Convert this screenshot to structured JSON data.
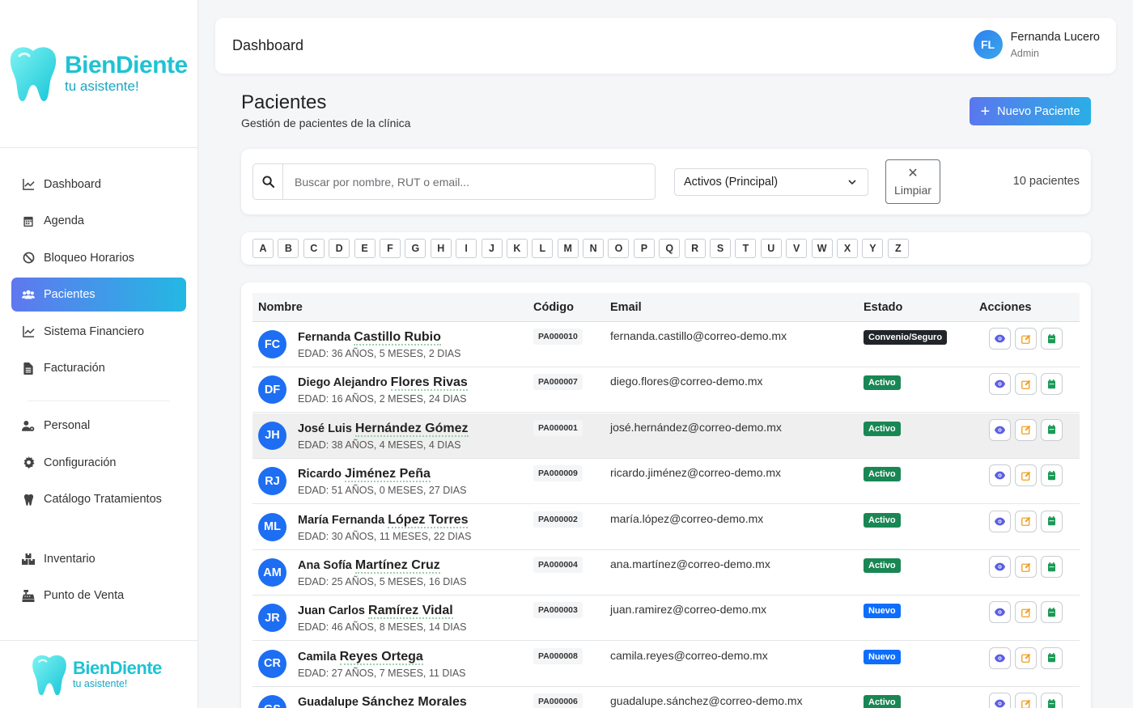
{
  "brand": {
    "name": "BienDiente",
    "tagline": "tu asistente!",
    "color": "#1ec3d2"
  },
  "sidebar": {
    "items": [
      {
        "label": "Dashboard",
        "icon": "line-chart-icon"
      },
      {
        "label": "Agenda",
        "icon": "calendar-icon"
      },
      {
        "label": "Bloqueo Horarios",
        "icon": "ban-icon"
      },
      {
        "label": "Pacientes",
        "icon": "users-icon",
        "active": true
      },
      {
        "label": "Sistema Financiero",
        "icon": "line-chart-icon"
      },
      {
        "label": "Facturación",
        "icon": "file-invoice-icon"
      },
      {
        "label": "Personal",
        "icon": "user-gear-icon"
      },
      {
        "label": "Configuración",
        "icon": "gear-icon"
      },
      {
        "label": "Catálogo Tratamientos",
        "icon": "tooth-icon"
      },
      {
        "label": "Inventario",
        "icon": "boxes-icon"
      },
      {
        "label": "Punto de Venta",
        "icon": "cash-register-icon"
      }
    ]
  },
  "header": {
    "title": "Dashboard",
    "user": {
      "initials": "FL",
      "name": "Fernanda Lucero",
      "role": "Admin"
    }
  },
  "page": {
    "title": "Pacientes",
    "subtitle": "Gestión de pacientes de la clínica",
    "new_button": "Nuevo Paciente"
  },
  "filters": {
    "search_placeholder": "Buscar por nombre, RUT o email...",
    "status_selected": "Activos (Principal)",
    "clear_label": "Limpiar",
    "count_label": "10 pacientes"
  },
  "alphabet": [
    "A",
    "B",
    "C",
    "D",
    "E",
    "F",
    "G",
    "H",
    "I",
    "J",
    "K",
    "L",
    "M",
    "N",
    "O",
    "P",
    "Q",
    "R",
    "S",
    "T",
    "U",
    "V",
    "W",
    "X",
    "Y",
    "Z"
  ],
  "table": {
    "headers": {
      "name": "Nombre",
      "code": "Código",
      "email": "Email",
      "status": "Estado",
      "actions": "Acciones"
    },
    "status_colors": {
      "Convenio/Seguro": "#212529",
      "Activo": "#198754",
      "Nuevo": "#0d6efd"
    },
    "rows": [
      {
        "initials": "FC",
        "first": "Fernanda",
        "last": "Castillo Rubio",
        "age": "EDAD: 36 AÑOS, 5 MESES, 2 DIAS",
        "code": "PA000010",
        "email": "fernanda.castillo@correo-demo.mx",
        "status": "Convenio/Seguro"
      },
      {
        "initials": "DF",
        "first": "Diego Alejandro",
        "last": "Flores Rivas",
        "age": "EDAD: 16 AÑOS, 2 MESES, 24 DIAS",
        "code": "PA000007",
        "email": "diego.flores@correo-demo.mx",
        "status": "Activo"
      },
      {
        "initials": "JH",
        "first": "José Luis",
        "last": "Hernández Gómez",
        "age": "EDAD: 38 AÑOS, 4 MESES, 4 DIAS",
        "code": "PA000001",
        "email": "josé.hernández@correo-demo.mx",
        "status": "Activo",
        "highlight": true
      },
      {
        "initials": "RJ",
        "first": "Ricardo",
        "last": "Jiménez Peña",
        "age": "EDAD: 51 AÑOS, 0 MESES, 27 DIAS",
        "code": "PA000009",
        "email": "ricardo.jiménez@correo-demo.mx",
        "status": "Activo"
      },
      {
        "initials": "ML",
        "first": "María Fernanda",
        "last": "López Torres",
        "age": "EDAD: 30 AÑOS, 11 MESES, 22 DIAS",
        "code": "PA000002",
        "email": "maría.lópez@correo-demo.mx",
        "status": "Activo"
      },
      {
        "initials": "AM",
        "first": "Ana Sofía",
        "last": "Martínez Cruz",
        "age": "EDAD: 25 AÑOS, 5 MESES, 16 DIAS",
        "code": "PA000004",
        "email": "ana.martínez@correo-demo.mx",
        "status": "Activo"
      },
      {
        "initials": "JR",
        "first": "Juan Carlos",
        "last": "Ramírez Vidal",
        "age": "EDAD: 46 AÑOS, 8 MESES, 14 DIAS",
        "code": "PA000003",
        "email": "juan.ramirez@correo-demo.mx",
        "status": "Nuevo"
      },
      {
        "initials": "CR",
        "first": "Camila",
        "last": "Reyes Ortega",
        "age": "EDAD: 27 AÑOS, 7 MESES, 11 DIAS",
        "code": "PA000008",
        "email": "camila.reyes@correo-demo.mx",
        "status": "Nuevo"
      },
      {
        "initials": "GS",
        "first": "Guadalupe",
        "last": "Sánchez Morales",
        "age": "",
        "code": "PA000006",
        "email": "guadalupe.sánchez@correo-demo.mx",
        "status": "Activo"
      }
    ]
  }
}
